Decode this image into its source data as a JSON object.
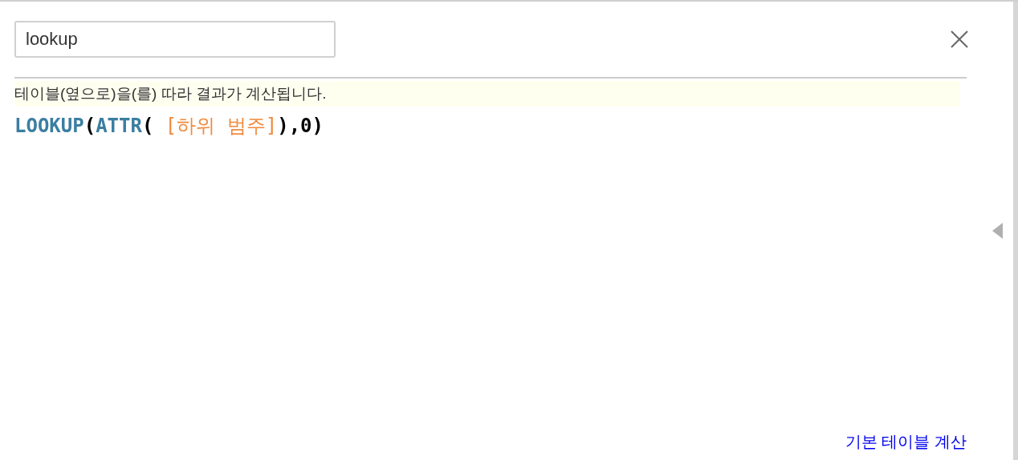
{
  "search": {
    "value": "lookup"
  },
  "hint": "테이블(옆으로)을(를) 따라 결과가 계산됩니다.",
  "formula": [
    {
      "kind": "function",
      "text": "LOOKUP"
    },
    {
      "kind": "punct",
      "text": "("
    },
    {
      "kind": "function",
      "text": "ATTR"
    },
    {
      "kind": "punct",
      "text": "( "
    },
    {
      "kind": "field",
      "text": "[하위 범주]"
    },
    {
      "kind": "punct",
      "text": "),0)"
    }
  ],
  "link": "기본 테이블 계산"
}
